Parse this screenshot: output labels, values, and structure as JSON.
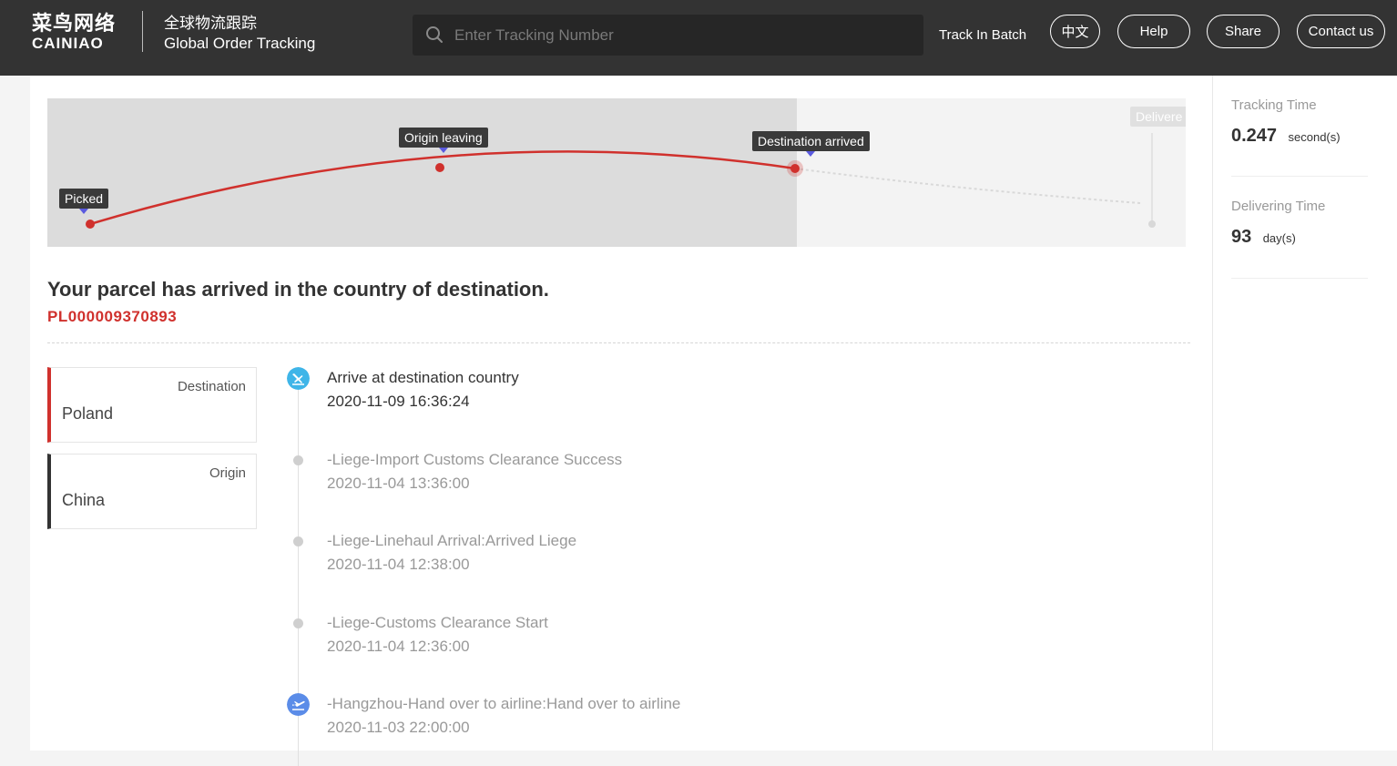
{
  "header": {
    "logo_cn": "菜鸟网络",
    "logo_en": "CAINIAO",
    "brand_cn": "全球物流跟踪",
    "brand_en": "Global Order Tracking",
    "search_placeholder": "Enter Tracking Number",
    "track_batch": "Track In Batch",
    "lang_button": "中文",
    "help_button": "Help",
    "share_button": "Share",
    "contact_button": "Contact us"
  },
  "map": {
    "labels": {
      "picked": "Picked",
      "origin_leaving": "Origin leaving",
      "destination_arrived": "Destination arrived",
      "delivered": "Delivere"
    },
    "route_color": "#d0312d"
  },
  "status": {
    "title": "Your parcel has arrived in the country of destination.",
    "tracking_number": "PL000009370893"
  },
  "locations": {
    "destination": {
      "kind": "Destination",
      "place": "Poland"
    },
    "origin": {
      "kind": "Origin",
      "place": "China"
    }
  },
  "timeline": [
    {
      "desc": "Arrive at destination country",
      "time": "2020-11-09 16:36:24",
      "icon": "plane-landing-icon",
      "state": "current"
    },
    {
      "desc": "-Liege-Import Customs Clearance Success",
      "time": "2020-11-04 13:36:00",
      "icon": "dot",
      "state": "past"
    },
    {
      "desc": "-Liege-Linehaul Arrival:Arrived Liege",
      "time": "2020-11-04 12:38:00",
      "icon": "dot",
      "state": "past"
    },
    {
      "desc": "-Liege-Customs Clearance Start",
      "time": "2020-11-04 12:36:00",
      "icon": "dot",
      "state": "past"
    },
    {
      "desc": "-Hangzhou-Hand over to airline:Hand over to airline",
      "time": "2020-11-03 22:00:00",
      "icon": "plane-takeoff-icon",
      "state": "past"
    }
  ],
  "stats": {
    "tracking_time": {
      "label": "Tracking Time",
      "value": "0.247",
      "unit": "second(s)"
    },
    "delivering_time": {
      "label": "Delivering Time",
      "value": "93",
      "unit": "day(s)"
    }
  },
  "colors": {
    "header_bg": "#333333",
    "accent_red": "#d0312d",
    "landing_icon": "#3fb5e8",
    "takeoff_icon": "#5b8ce8"
  }
}
